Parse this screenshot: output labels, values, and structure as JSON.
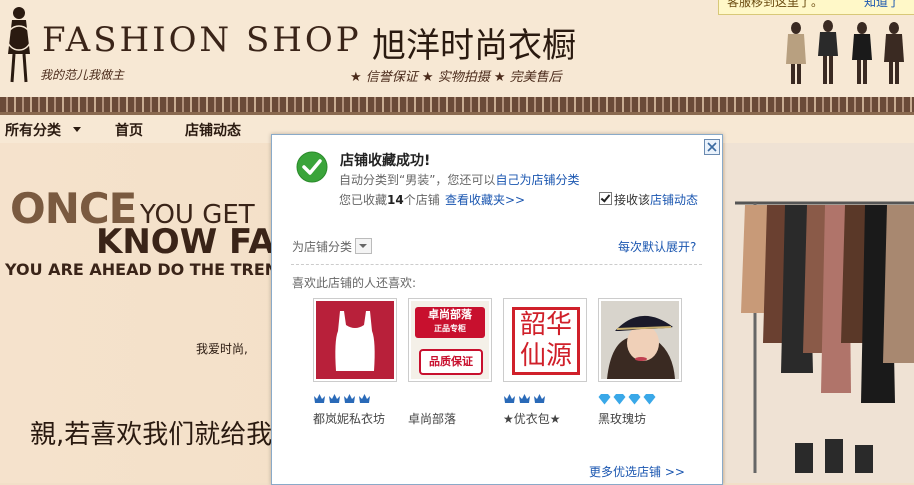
{
  "ad_tip": {
    "text": "客服移到这里了。",
    "know": "知道了"
  },
  "header": {
    "logo_text": "FASHION SHOP",
    "logo_slogan": "我的范儿我做主",
    "shop_title": "旭洋时尚衣橱",
    "promise": "★ 信誉保证  ★ 实物拍摄  ★ 完美售后"
  },
  "nav": {
    "items": [
      {
        "label": "所有分类"
      },
      {
        "label": "首页"
      },
      {
        "label": "店铺动态"
      }
    ]
  },
  "banner": {
    "once": "ONCE",
    "you_get": "YOU GET",
    "know": "KNOW FA",
    "ahead": "YOU ARE AHEAD DO THE TREN",
    "love": "我爱时尚,",
    "qin": "親,若喜欢我们就给我"
  },
  "dialog": {
    "title": "店铺收藏成功!",
    "auto_prefix": "自动分类到“男装”，您还可以",
    "auto_link": "自己为店铺分类",
    "count_prefix": "您已收藏",
    "count_value": "14",
    "count_suffix": "个店铺",
    "view_fav": "查看收藏夹>>",
    "follow_checked": true,
    "follow_prefix": "接收该",
    "follow_link": "店铺动态",
    "category_label": "为店铺分类",
    "expand_link": "每次默认展开?",
    "like_label": "喜欢此店铺的人还喜欢:",
    "recommendations": [
      {
        "name": "都岚妮私衣坊",
        "badge_type": "crown",
        "badge_count": 4,
        "image": "red-tank-top",
        "img_text": ""
      },
      {
        "name": "卓尚部落",
        "badge_type": "none",
        "badge_count": 0,
        "image": "shop-logo",
        "img_text": "卓尚部落",
        "img_sub": "正品专柜",
        "img_tag": "品质保证"
      },
      {
        "name": "★优衣包★",
        "badge_type": "crown",
        "badge_count": 3,
        "image": "red-seal",
        "img_text": "韶华仙源"
      },
      {
        "name": "黑玫瑰坊",
        "badge_type": "diamond",
        "badge_count": 4,
        "image": "woman-hat",
        "img_text": ""
      }
    ],
    "more_link": "更多优选店铺 >>"
  },
  "colors": {
    "link": "#1a56b0",
    "crown": "#2a6ab8",
    "diamond": "#3aa8e8",
    "check": "#3aa43a"
  }
}
